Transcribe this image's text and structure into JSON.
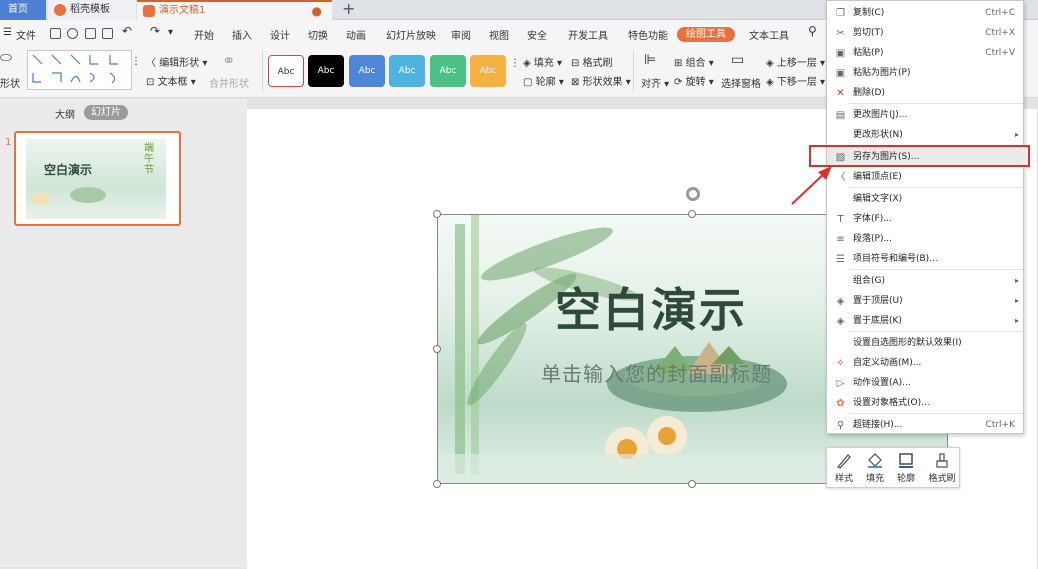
{
  "tabs": {
    "home": "首页",
    "templates": "稻壳模板",
    "document": "演示文稿1",
    "add": "+",
    "modified_dot": "●"
  },
  "menubar": {
    "file": "文件",
    "items": [
      "开始",
      "插入",
      "设计",
      "切换",
      "动画",
      "幻灯片放映",
      "审阅",
      "视图",
      "安全",
      "开发工具",
      "特色功能"
    ],
    "active_tab": "绘图工具",
    "text_tool": "文本工具"
  },
  "ribbon": {
    "shape_label": "形状",
    "edit_shape": "编辑形状",
    "textbox": "文本框",
    "merge_shape": "合并形状",
    "style_preview_text": "Abc",
    "style_colors": [
      "#ffffff",
      "#000000",
      "#4f86d9",
      "#4fb3e0",
      "#4cc187",
      "#f5b240"
    ],
    "fill": "填充",
    "outline": "轮廓",
    "format_brush": "格式刷",
    "shape_effect": "形状效果",
    "align": "对齐",
    "group": "组合",
    "rotate": "旋转",
    "selection_pane": "选择窗格",
    "bring_forward": "上移一层",
    "send_backward": "下移一层"
  },
  "left_panel": {
    "outline_tab": "大纲",
    "slides_tab": "幻灯片",
    "slide_number": "1",
    "thumb_title": "空白演示",
    "thumb_side": "端午节"
  },
  "slide": {
    "title": "空白演示",
    "subtitle": "单击输入您的封面副标题"
  },
  "context_menu": [
    {
      "label": "复制(C)",
      "shortcut": "Ctrl+C",
      "icon": "copy-icon",
      "glyph": "❐"
    },
    {
      "label": "剪切(T)",
      "shortcut": "Ctrl+X",
      "icon": "scissors-icon",
      "glyph": "✂"
    },
    {
      "label": "粘贴(P)",
      "shortcut": "Ctrl+V",
      "icon": "paste-icon",
      "glyph": "▣"
    },
    {
      "label": "粘贴为图片(P)",
      "shortcut": "",
      "icon": "paste-image-icon",
      "glyph": "▣"
    },
    {
      "label": "删除(D)",
      "shortcut": "",
      "icon": "delete-icon",
      "glyph": "✕"
    },
    {
      "label": "更改图片(J)...",
      "shortcut": "",
      "icon": "change-picture-icon",
      "glyph": "▤"
    },
    {
      "label": "更改形状(N)",
      "shortcut": "",
      "icon": "",
      "glyph": "",
      "submenu": true
    },
    {
      "label": "另存为图片(S)...",
      "shortcut": "",
      "icon": "save-as-picture-icon",
      "glyph": "▨"
    },
    {
      "label": "编辑顶点(E)",
      "shortcut": "",
      "icon": "edit-points-icon",
      "glyph": "〈"
    },
    {
      "label": "编辑文字(X)",
      "shortcut": "",
      "icon": "",
      "glyph": ""
    },
    {
      "label": "字体(F)...",
      "shortcut": "",
      "icon": "font-icon",
      "glyph": "T"
    },
    {
      "label": "段落(P)...",
      "shortcut": "",
      "icon": "paragraph-icon",
      "glyph": "≡"
    },
    {
      "label": "项目符号和编号(B)...",
      "shortcut": "",
      "icon": "bullets-icon",
      "glyph": "☰"
    },
    {
      "label": "组合(G)",
      "shortcut": "",
      "icon": "",
      "glyph": "",
      "submenu": true
    },
    {
      "label": "置于顶层(U)",
      "shortcut": "",
      "icon": "bring-to-front-icon",
      "glyph": "◈",
      "submenu": true
    },
    {
      "label": "置于底层(K)",
      "shortcut": "",
      "icon": "send-to-back-icon",
      "glyph": "◈",
      "submenu": true
    },
    {
      "label": "设置自选图形的默认效果(I)",
      "shortcut": "",
      "icon": "",
      "glyph": ""
    },
    {
      "label": "自定义动画(M)...",
      "shortcut": "",
      "icon": "custom-animation-icon",
      "glyph": "✧"
    },
    {
      "label": "动作设置(A)...",
      "shortcut": "",
      "icon": "action-icon",
      "glyph": "▷"
    },
    {
      "label": "设置对象格式(O)...",
      "shortcut": "",
      "icon": "format-object-icon",
      "glyph": "✿"
    },
    {
      "label": "超链接(H)...",
      "shortcut": "Ctrl+K",
      "icon": "hyperlink-icon",
      "glyph": "⚲"
    }
  ],
  "mini_toolbar": {
    "style": "样式",
    "fill": "填充",
    "outline": "轮廓",
    "format_brush": "格式刷"
  },
  "colors": {
    "accent": "#e8723a",
    "highlight": "#d9322b"
  }
}
